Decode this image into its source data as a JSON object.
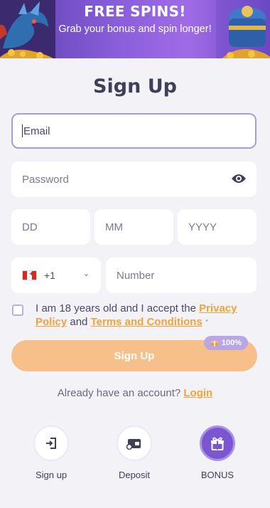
{
  "banner": {
    "title": "FREE SPINS!",
    "subtitle": "Grab your bonus and spin longer!"
  },
  "page": {
    "title": "Sign Up"
  },
  "form": {
    "email_placeholder": "Email",
    "password_placeholder": "Password",
    "dob": {
      "day": "DD",
      "month": "MM",
      "year": "YYYY"
    },
    "phone": {
      "country_code": "+1",
      "country": "Canada",
      "number_placeholder": "Number"
    },
    "terms": {
      "text_before": "I am 18 years old and I accept the ",
      "privacy_link": "Privacy Policy",
      "and": " and ",
      "terms_link": "Terms and Conditions",
      "required_mark": "*"
    },
    "submit_label": "Sign Up",
    "bonus_badge": "100%"
  },
  "login": {
    "prompt": "Already have an account?",
    "link": "Login"
  },
  "bottom_nav": [
    {
      "label": "Sign up",
      "icon": "sign-in-icon"
    },
    {
      "label": "Deposit",
      "icon": "wallet-icon"
    },
    {
      "label": "BONUS",
      "icon": "gift-icon",
      "active": true
    }
  ],
  "colors": {
    "accent": "#f0a33a",
    "button": "#f7c08a",
    "purple": "#7a56d0",
    "background": "#f3f2f7"
  }
}
